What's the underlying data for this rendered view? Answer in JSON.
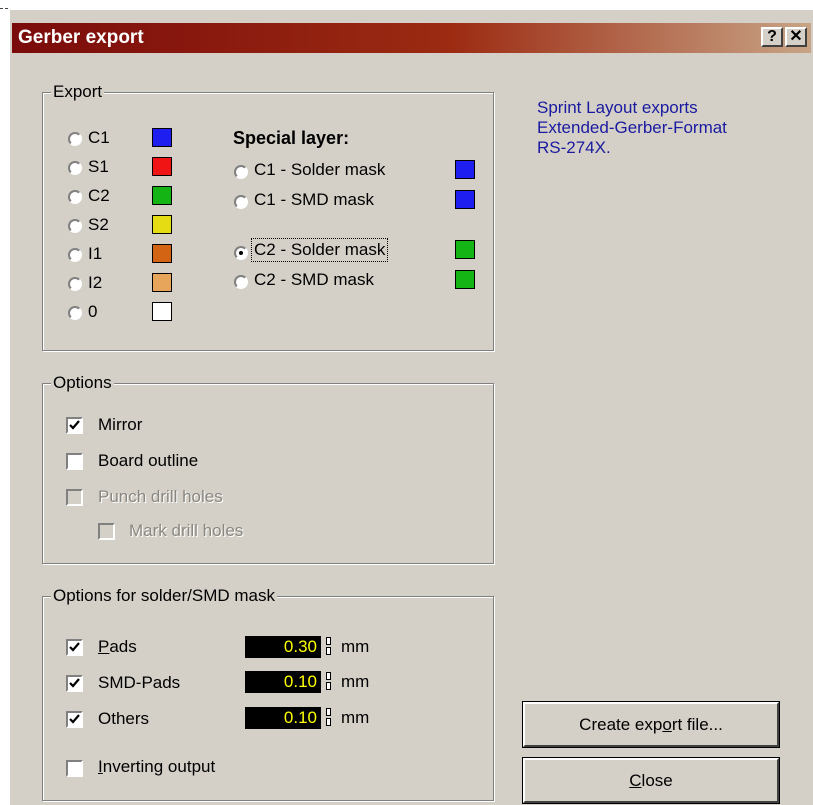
{
  "window": {
    "title": "Gerber export",
    "help_label": "?",
    "close_label": "✕"
  },
  "export_group": {
    "label": "Export",
    "layers": [
      {
        "label": "C1",
        "color": "#1e1ef0",
        "selected": false
      },
      {
        "label": "S1",
        "color": "#f01414",
        "selected": false
      },
      {
        "label": "C2",
        "color": "#14b414",
        "selected": false
      },
      {
        "label": "S2",
        "color": "#e6dc14",
        "selected": false
      },
      {
        "label": "I1",
        "color": "#d26414",
        "selected": false
      },
      {
        "label": "I2",
        "color": "#e6a55a",
        "selected": false
      },
      {
        "label": "0",
        "color": "#ffffff",
        "selected": false
      }
    ],
    "special_title": "Special layer:",
    "special_layers": [
      {
        "label": "C1 - Solder mask",
        "color": "#1e1ef0",
        "selected": false
      },
      {
        "label": "C1 - SMD mask",
        "color": "#1e1ef0",
        "selected": false
      },
      {
        "label": "C2 - Solder mask",
        "color": "#14b414",
        "selected": true
      },
      {
        "label": "C2 - SMD mask",
        "color": "#14b414",
        "selected": false
      }
    ]
  },
  "options_group": {
    "label": "Options",
    "items": [
      {
        "label": "Mirror",
        "checked": true,
        "enabled": true
      },
      {
        "label": "Board outline",
        "checked": false,
        "enabled": true
      },
      {
        "label": "Punch drill holes",
        "checked": false,
        "enabled": false
      },
      {
        "label": "Mark drill holes",
        "checked": false,
        "enabled": false
      }
    ]
  },
  "mask_group": {
    "label": "Options for solder/SMD mask",
    "items": [
      {
        "label": "Pads",
        "checked": true,
        "value": "0.30",
        "unit": "mm"
      },
      {
        "label": "SMD-Pads",
        "checked": true,
        "value": "0.10",
        "unit": "mm"
      },
      {
        "label": "Others",
        "checked": true,
        "value": "0.10",
        "unit": "mm"
      }
    ],
    "invert": {
      "label": "Inverting output",
      "checked": false
    }
  },
  "info_text": [
    "Sprint Layout exports",
    "Extended-Gerber-Format",
    "RS-274X."
  ],
  "buttons": {
    "create": "Create export file...",
    "close": "Close"
  }
}
